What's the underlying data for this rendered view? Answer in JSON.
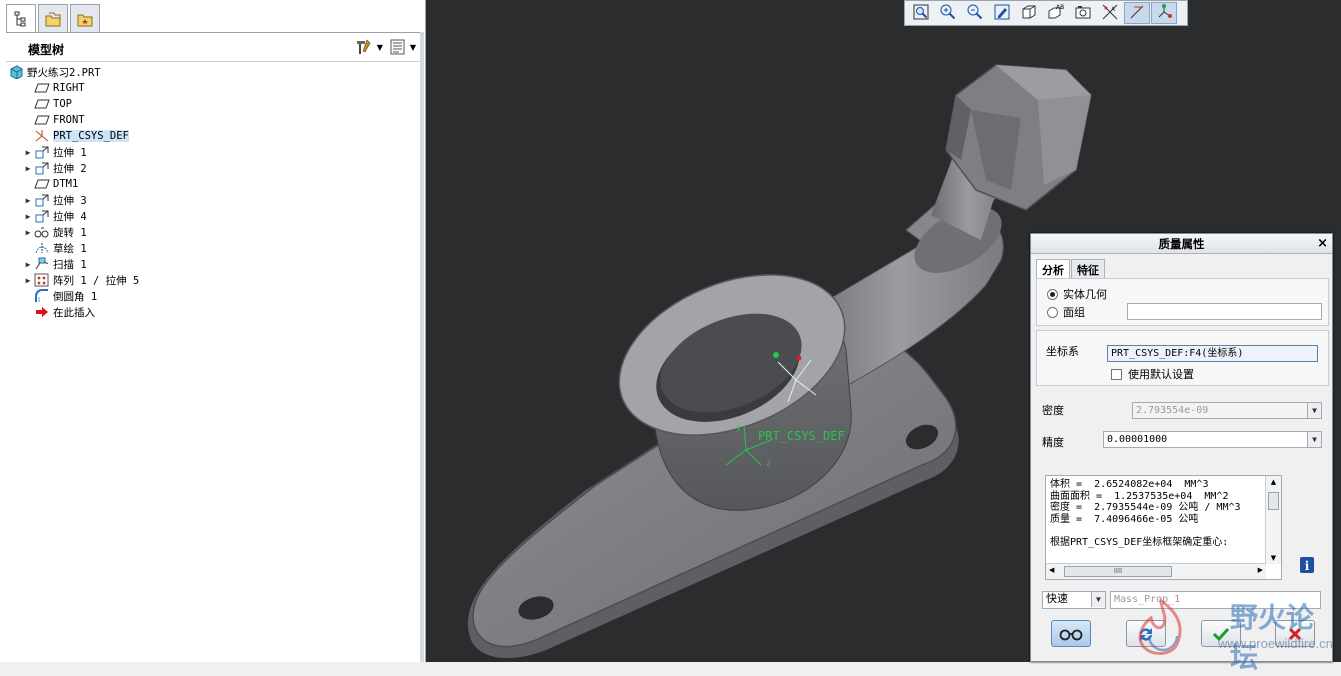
{
  "left_panel": {
    "header_title": "模型树",
    "tree": [
      {
        "label": "野火练习2.PRT",
        "icon": "part-icon",
        "expandable": false,
        "root": true
      },
      {
        "label": "RIGHT",
        "icon": "datum-plane-icon",
        "expandable": false
      },
      {
        "label": "TOP",
        "icon": "datum-plane-icon",
        "expandable": false
      },
      {
        "label": "FRONT",
        "icon": "datum-plane-icon",
        "expandable": false
      },
      {
        "label": "PRT_CSYS_DEF",
        "icon": "csys-icon",
        "expandable": false,
        "selected": true
      },
      {
        "label": "拉伸 1",
        "icon": "extrude-icon",
        "expandable": true
      },
      {
        "label": "拉伸 2",
        "icon": "extrude-icon",
        "expandable": true
      },
      {
        "label": "DTM1",
        "icon": "datum-plane-icon",
        "expandable": false
      },
      {
        "label": "拉伸 3",
        "icon": "extrude-icon",
        "expandable": true
      },
      {
        "label": "拉伸 4",
        "icon": "extrude-icon",
        "expandable": true
      },
      {
        "label": "旋转 1",
        "icon": "revolve-icon",
        "expandable": true
      },
      {
        "label": "草绘 1",
        "icon": "sketch-icon",
        "expandable": false
      },
      {
        "label": "扫描 1",
        "icon": "sweep-icon",
        "expandable": true
      },
      {
        "label": "阵列 1 / 拉伸 5",
        "icon": "pattern-icon",
        "expandable": true
      },
      {
        "label": "倒圆角 1",
        "icon": "round-icon",
        "expandable": false
      },
      {
        "label": "在此插入",
        "icon": "insert-here-icon",
        "expandable": false
      }
    ]
  },
  "viewport": {
    "csys_label": "PRT_CSYS_DEF",
    "toolbar": [
      "zoom-fit-icon",
      "zoom-in-icon",
      "zoom-out-icon",
      "repaint-icon",
      "display-style-icon",
      "saved-views-icon",
      "view-manager-icon",
      "datum-display-icon",
      "annotation-display-icon",
      "csys-display-icon"
    ]
  },
  "dialog": {
    "title": "质量属性",
    "tabs": [
      "分析",
      "特征"
    ],
    "radio_solid": "实体几何",
    "radio_quilt": "面组",
    "csys_label": "坐标系",
    "csys_value": "PRT_CSYS_DEF:F4(坐标系)",
    "use_default": "使用默认设置",
    "density_label": "密度",
    "density_value": "2.793554e-09",
    "accuracy_label": "精度",
    "accuracy_value": "0.00001000",
    "results_text": "体积 =  2.6524082e+04  MM^3\n曲面面积 =  1.2537535e+04  MM^2\n密度 =  2.7935544e-09 公吨 / MM^3\n质量 =  7.4096466e-05 公吨\n\n根据PRT_CSYS_DEF坐标框架确定重心:",
    "scroll_grip": "IIII",
    "mode_value": "快速",
    "name_value": "Mass_Prop_1"
  },
  "watermark": {
    "title": "野火论坛",
    "url": "www.proewildfire.cn"
  }
}
